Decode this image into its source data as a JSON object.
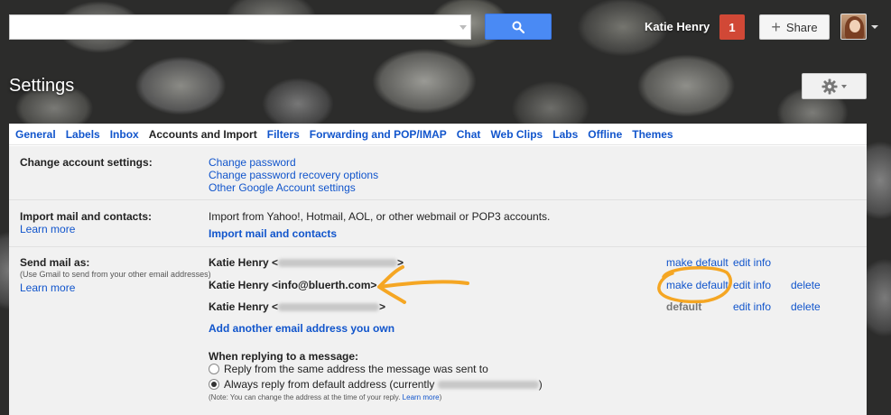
{
  "header": {
    "search_placeholder": "",
    "user_name": "Katie Henry",
    "notification_count": "1",
    "share_label": "Share",
    "page_title": "Settings"
  },
  "tabs": [
    {
      "label": "General"
    },
    {
      "label": "Labels"
    },
    {
      "label": "Inbox"
    },
    {
      "label": "Accounts and Import",
      "active": true
    },
    {
      "label": "Filters"
    },
    {
      "label": "Forwarding and POP/IMAP"
    },
    {
      "label": "Chat"
    },
    {
      "label": "Web Clips"
    },
    {
      "label": "Labs"
    },
    {
      "label": "Offline"
    },
    {
      "label": "Themes"
    }
  ],
  "change_account": {
    "label": "Change account settings:",
    "links": [
      "Change password",
      "Change password recovery options",
      "Other Google Account settings"
    ]
  },
  "import": {
    "label": "Import mail and contacts:",
    "learn_more": "Learn more",
    "description": "Import from Yahoo!, Hotmail, AOL, or other webmail or POP3 accounts.",
    "action_link": "Import mail and contacts"
  },
  "send_mail": {
    "label": "Send mail as:",
    "sub_note": "(Use Gmail to send from your other email addresses)",
    "learn_more": "Learn more",
    "addresses": [
      {
        "name_prefix": "Katie Henry <",
        "suffix": ">",
        "make_default": "make default",
        "edit": "edit info"
      },
      {
        "full": "Katie Henry <info@bluerth.com>",
        "make_default": "make default",
        "edit": "edit info",
        "delete": "delete"
      },
      {
        "name_prefix": "Katie Henry <",
        "suffix": ">",
        "default_label": "default",
        "edit": "edit info",
        "delete": "delete"
      }
    ],
    "add_link": "Add another email address you own",
    "reply_heading": "When replying to a message:",
    "reply_options": [
      {
        "label": "Reply from the same address the message was sent to",
        "selected": false
      },
      {
        "label_prefix": "Always reply from default address (currently",
        "label_suffix": ")",
        "selected": true
      }
    ],
    "note_prefix": "(Note: You can change the address at the time of your reply.",
    "note_link": "Learn more",
    "note_suffix": ")"
  },
  "colors": {
    "accent_blue": "#4a8af4",
    "link": "#1155cc",
    "notification_red": "#d14836",
    "annotation_orange": "#f5a623"
  },
  "icons": [
    "search-icon",
    "plus-icon",
    "gear-icon",
    "chevron-down-icon",
    "radio-icon"
  ]
}
